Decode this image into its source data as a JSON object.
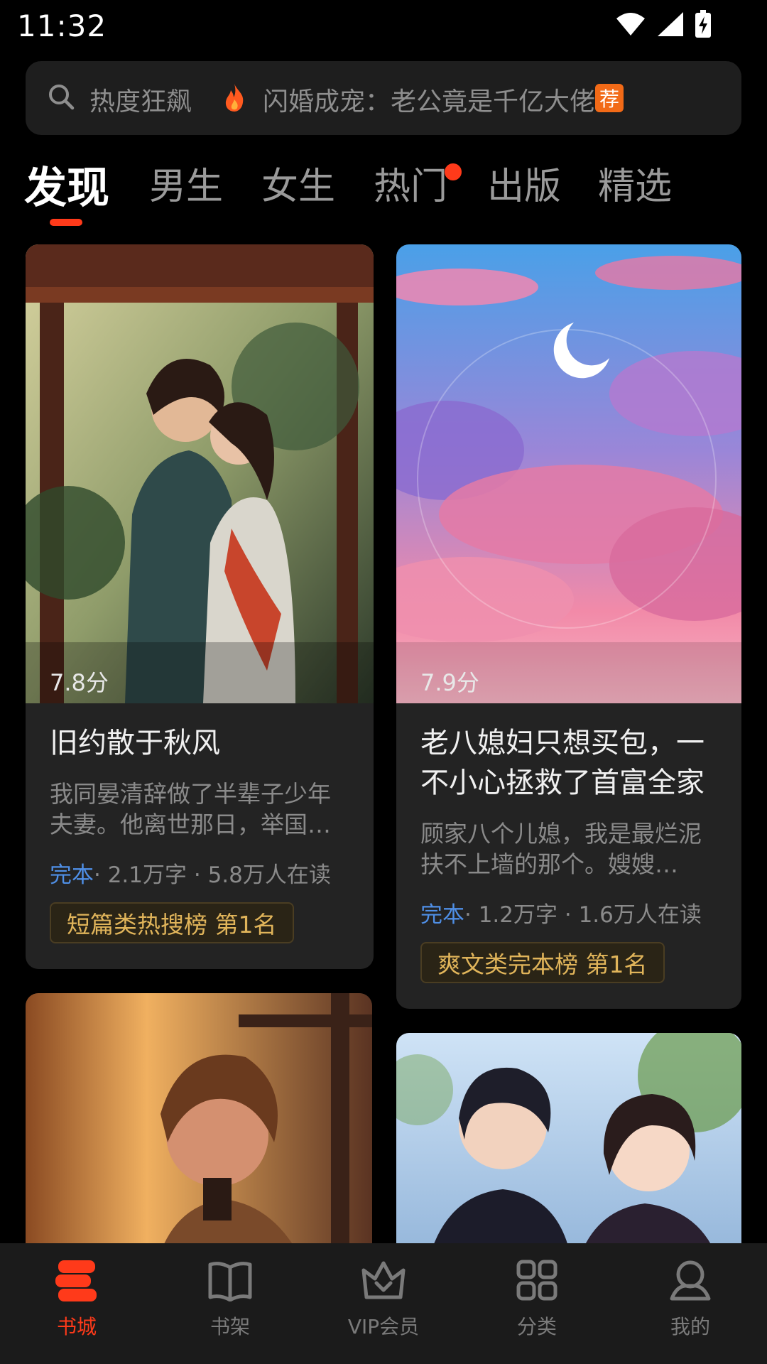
{
  "status_bar": {
    "time": "11:32"
  },
  "search": {
    "hot_label": "热度狂飙",
    "query": "闪婚成宠：老公竟是千亿大佬",
    "badge": "荐"
  },
  "tabs": [
    {
      "label": "发现",
      "active": true
    },
    {
      "label": "男生"
    },
    {
      "label": "女生"
    },
    {
      "label": "热门",
      "dot": true
    },
    {
      "label": "出版"
    },
    {
      "label": "精选"
    }
  ],
  "books": [
    {
      "score": "7.8分",
      "title": "旧约散于秋风",
      "desc": "我同晏清辞做了半辈子少年夫妻。他离世那日，举国哀悼……",
      "status": "完本",
      "meta": "· 2.1万字 · 5.8万人在读",
      "rank": "短篇类热搜榜   第1名"
    },
    {
      "score": "7.9分",
      "title": "老八媳妇只想买包，一不小心拯救了首富全家",
      "desc": "顾家八个儿媳，我是最烂泥扶不上墙的那个。嫂嫂们……",
      "status": "完本",
      "meta": "· 1.2万字 · 1.6万人在读",
      "rank": "爽文类完本榜   第1名"
    }
  ],
  "bottom_nav": [
    {
      "label": "书城",
      "active": true
    },
    {
      "label": "书架"
    },
    {
      "label": "VIP会员"
    },
    {
      "label": "分类"
    },
    {
      "label": "我的"
    }
  ],
  "colors": {
    "accent": "#ff3a1a",
    "badge": "#f26a17",
    "status_blue": "#4f8fe6",
    "rank_gold": "#e0b45a"
  }
}
